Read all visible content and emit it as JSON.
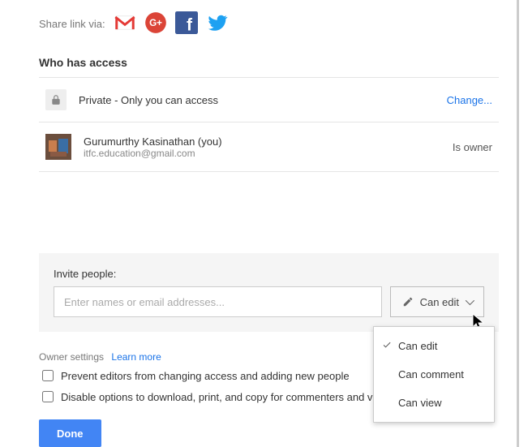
{
  "share": {
    "label": "Share link via:",
    "icons": [
      "gmail",
      "gplus",
      "facebook",
      "twitter"
    ]
  },
  "access": {
    "title": "Who has access",
    "privacy": {
      "text": "Private - Only you can access",
      "change": "Change..."
    },
    "owner": {
      "name": "Gurumurthy Kasinathan (you)",
      "email": "itfc.education@gmail.com",
      "role": "Is owner"
    }
  },
  "invite": {
    "label": "Invite people:",
    "placeholder": "Enter names or email addresses...",
    "perm_button": "Can edit",
    "options": [
      {
        "label": "Can edit",
        "selected": true
      },
      {
        "label": "Can comment",
        "selected": false
      },
      {
        "label": "Can view",
        "selected": false
      }
    ]
  },
  "owner_settings": {
    "label": "Owner settings",
    "learn": "Learn more",
    "opt1": "Prevent editors from changing access and adding new people",
    "opt2": "Disable options to download, print, and copy for commenters and vi"
  },
  "done": "Done"
}
